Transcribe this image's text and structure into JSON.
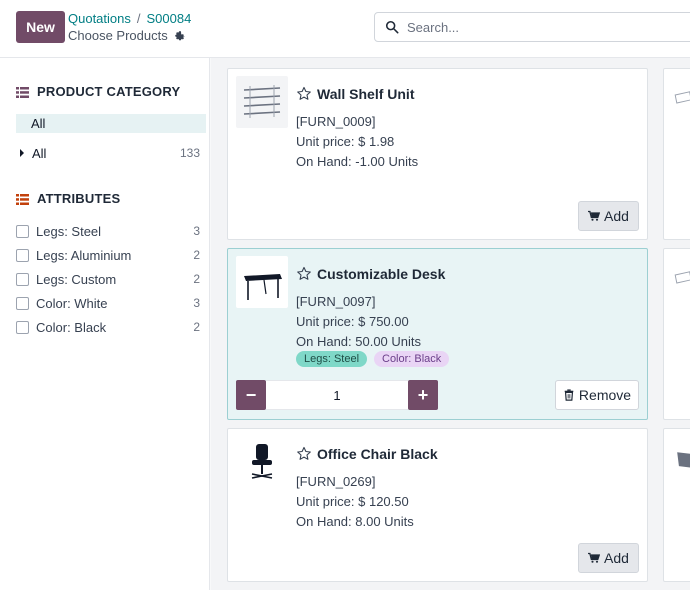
{
  "header": {
    "new_label": "New",
    "breadcrumb": {
      "parent": "Quotations",
      "separator": "/",
      "current": "S00084"
    },
    "subtitle": "Choose Products",
    "search_placeholder": "Search..."
  },
  "sidebar": {
    "category_title": "PRODUCT CATEGORY",
    "category_active": "All",
    "category_row": {
      "label": "All",
      "count": "133"
    },
    "attributes_title": "ATTRIBUTES",
    "attributes": [
      {
        "label": "Legs: Steel",
        "count": "3"
      },
      {
        "label": "Legs: Aluminium",
        "count": "2"
      },
      {
        "label": "Legs: Custom",
        "count": "2"
      },
      {
        "label": "Color: White",
        "count": "3"
      },
      {
        "label": "Color: Black",
        "count": "2"
      }
    ]
  },
  "products": [
    {
      "name": "Wall Shelf Unit",
      "code": "[FURN_0009]",
      "price": "Unit price: $ 1.98",
      "on_hand": "On Hand: -1.00 Units",
      "action": "Add"
    },
    {
      "name": "Customizable Desk",
      "code": "[FURN_0097]",
      "price": "Unit price: $ 750.00",
      "on_hand": "On Hand: 50.00 Units",
      "tags": [
        "Legs: Steel",
        "Color: Black"
      ],
      "quantity": "1",
      "action": "Remove"
    },
    {
      "name": "Office Chair Black",
      "code": "[FURN_0269]",
      "price": "Unit price: $ 120.50",
      "on_hand": "On Hand: 8.00 Units",
      "action": "Add"
    }
  ],
  "colors": {
    "brand": "#714b67",
    "link": "#017e84",
    "selected_bg": "#e8f4f5"
  }
}
